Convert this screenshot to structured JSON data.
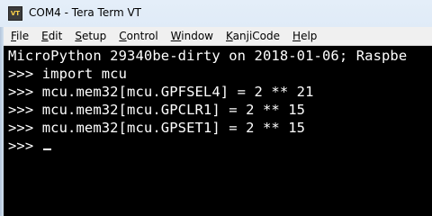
{
  "window": {
    "title": "COM4 - Tera Term VT",
    "icon_label": "VT"
  },
  "menu": {
    "items": [
      {
        "mnemonic": "F",
        "rest": "ile"
      },
      {
        "mnemonic": "E",
        "rest": "dit"
      },
      {
        "mnemonic": "S",
        "rest": "etup"
      },
      {
        "mnemonic": "C",
        "rest": "ontrol"
      },
      {
        "mnemonic": "W",
        "rest": "indow"
      },
      {
        "mnemonic": "K",
        "rest": "anjiCode"
      },
      {
        "mnemonic": "H",
        "rest": "elp"
      }
    ]
  },
  "terminal": {
    "lines": [
      "MicroPython 29340be-dirty on 2018-01-06; Raspbe",
      ">>> import mcu",
      ">>> mcu.mem32[mcu.GPFSEL4] = 2 ** 21",
      ">>> mcu.mem32[mcu.GPCLR1] = 2 ** 15",
      ">>> mcu.mem32[mcu.GPSET1] = 2 ** 15",
      ">>> "
    ]
  }
}
